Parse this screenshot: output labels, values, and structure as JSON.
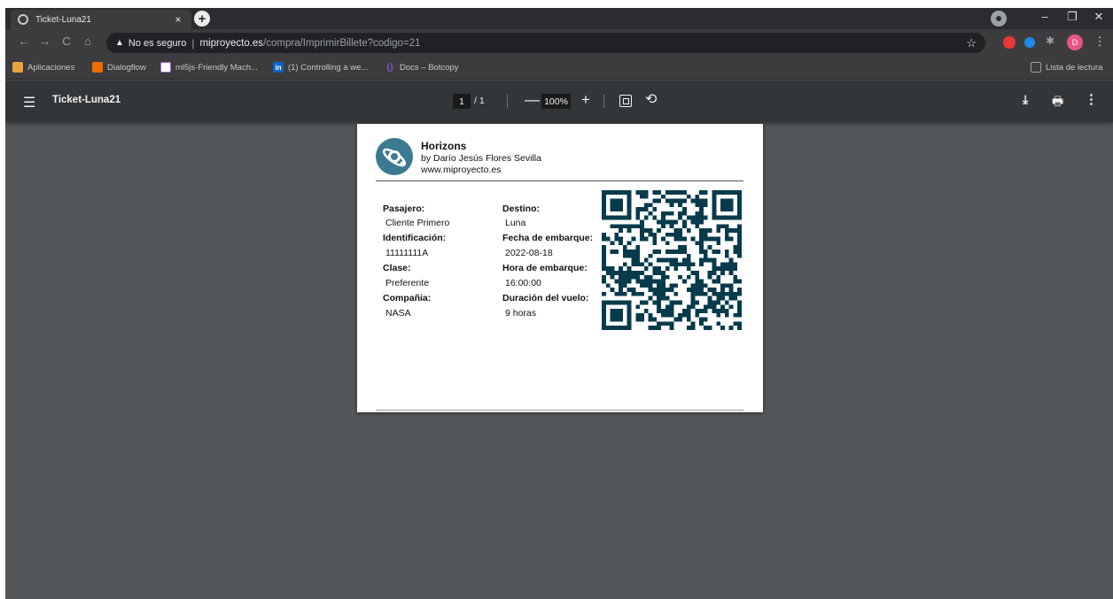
{
  "browser": {
    "tab_title": "Ticket-Luna21",
    "tab_close": "×",
    "new_tab": "+",
    "window_controls": {
      "minimize": "–",
      "restore": "❐",
      "close": "✕"
    },
    "nav": {
      "back": "←",
      "forward": "→",
      "reload": "C",
      "home": "⌂"
    },
    "security_icon": "▲",
    "security_label": "No es seguro",
    "url_host": "miproyecto.es",
    "url_path": "/compra/ImprimirBillete?codigo=21",
    "star": "☆",
    "profile_initial": "D",
    "extension_menu": "⋮",
    "bookmarks": [
      {
        "label": "Aplicaciones",
        "icon": "apps-grid-icon",
        "color": "#e8a33d"
      },
      {
        "label": "Dialogflow",
        "icon": "dialogflow-icon",
        "color": "#ef6c00"
      },
      {
        "label": "ml5js·Friendly Mach...",
        "icon": "ml5js-icon",
        "color": "#a066d3"
      },
      {
        "label": "(1) Controlling a we...",
        "icon": "linkedin-icon",
        "color": "#0a66c2"
      },
      {
        "label": "Docs – Botcopy",
        "icon": "docs-icon",
        "color": "#7e57c2"
      }
    ],
    "reading_list": "Lista de lectura"
  },
  "pdf_toolbar": {
    "menu_icon": "☰",
    "title": "Ticket-Luna21",
    "current_page": "1",
    "total_pages": "/ 1",
    "zoom_out": "—",
    "zoom": "100%",
    "zoom_in": "+",
    "rotate_icon": "⟲",
    "download_icon": "⤓",
    "print_icon": "🖶",
    "more_icon": "⋮"
  },
  "ticket": {
    "brand": "Horizons",
    "byline": "by Darío Jesús Flores Sevilla",
    "website": "www.miproyecto.es",
    "left": [
      {
        "label": "Pasajero:",
        "value": "Cliente Primero"
      },
      {
        "label": "Identificación:",
        "value": "11111111A"
      },
      {
        "label": "Clase:",
        "value": "Preferente"
      },
      {
        "label": "Compañia:",
        "value": "NASA"
      }
    ],
    "right": [
      {
        "label": "Destino:",
        "value": "Luna"
      },
      {
        "label": "Fecha de embarque:",
        "value": "2022-08-18"
      },
      {
        "label": "Hora de embarque:",
        "value": "16:00:00"
      },
      {
        "label": "Duración del vuelo:",
        "value": "9 horas"
      }
    ],
    "qr_color": "#073b4c",
    "logo_color": "#3d7a91"
  }
}
